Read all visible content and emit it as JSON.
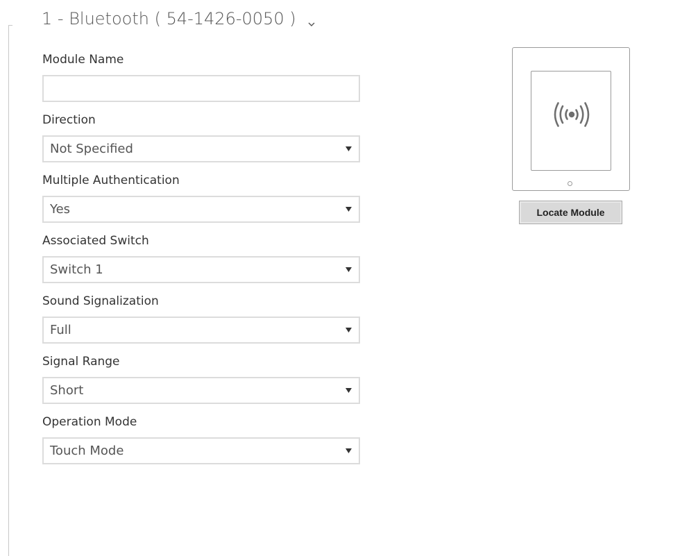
{
  "section": {
    "title": "1 - Bluetooth ( 54-1426-0050 )",
    "toggle_icon": "chevron-down-icon"
  },
  "fields": {
    "module_name": {
      "label": "Module Name",
      "value": "",
      "placeholder": ""
    },
    "direction": {
      "label": "Direction",
      "value": "Not Specified"
    },
    "multiple_authentication": {
      "label": "Multiple Authentication",
      "value": "Yes"
    },
    "associated_switch": {
      "label": "Associated Switch",
      "value": "Switch 1"
    },
    "sound_signalization": {
      "label": "Sound Signalization",
      "value": "Full"
    },
    "signal_range": {
      "label": "Signal Range",
      "value": "Short"
    },
    "operation_mode": {
      "label": "Operation Mode",
      "value": "Touch Mode"
    }
  },
  "module_preview": {
    "icon": "wireless-signal-icon",
    "locate_button_label": "Locate Module"
  },
  "colors": {
    "border": "#dcdcdc",
    "text": "#333333",
    "button_bg": "#d9d9d9"
  }
}
